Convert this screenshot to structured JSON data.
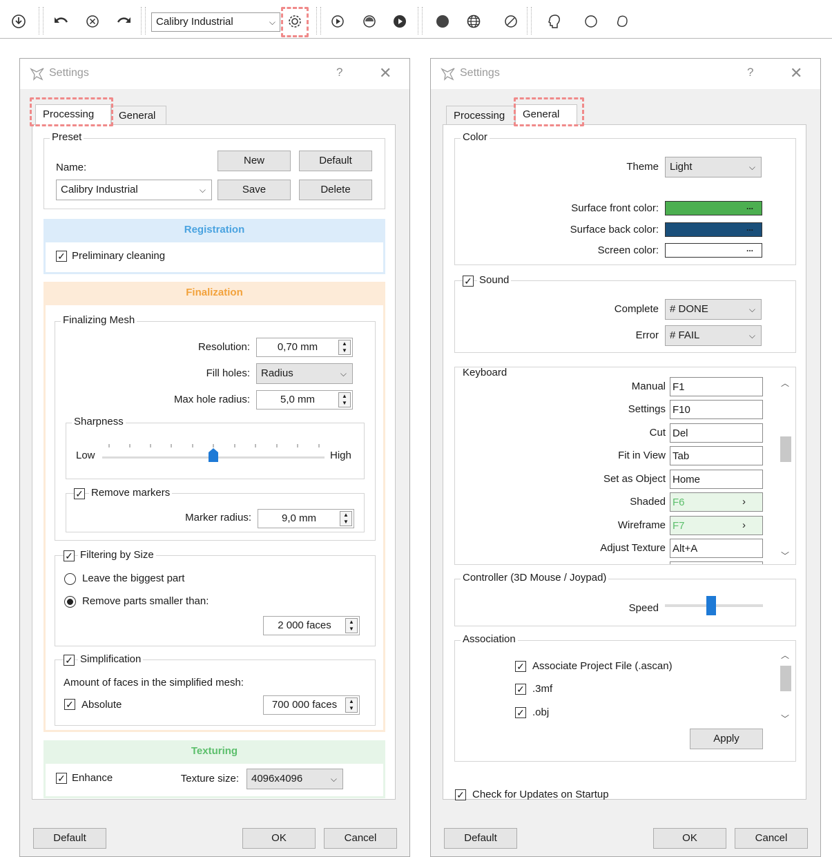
{
  "toolbar": {
    "preset_value": "Calibry Industrial",
    "icons": [
      "download-icon",
      "undo-icon",
      "cancel-icon",
      "redo-icon",
      "settings-gear-icon",
      "play-icon",
      "texture-icon",
      "play-filled-icon",
      "sphere-icon",
      "globe-icon",
      "block-icon",
      "head-icon",
      "circle-icon",
      "shape-icon"
    ]
  },
  "left": {
    "title": "Settings",
    "help": "?",
    "close": "✕",
    "tabs": {
      "processing": "Processing",
      "general": "General"
    },
    "preset": {
      "group": "Preset",
      "name_label": "Name:",
      "name_value": "Calibry Industrial",
      "new": "New",
      "default": "Default",
      "save": "Save",
      "delete": "Delete"
    },
    "registration": {
      "head": "Registration",
      "preliminary": "Preliminary cleaning"
    },
    "finalization": {
      "head": "Finalization",
      "mesh_group": "Finalizing Mesh",
      "resolution_label": "Resolution:",
      "resolution_value": "0,70 mm",
      "fill_label": "Fill holes:",
      "fill_value": "Radius",
      "maxhole_label": "Max hole radius:",
      "maxhole_value": "5,0 mm",
      "sharpness_group": "Sharpness",
      "low": "Low",
      "high": "High",
      "markers_group": "Remove markers",
      "marker_label": "Marker radius:",
      "marker_value": "9,0 mm",
      "filtering_group": "Filtering by Size",
      "biggest": "Leave the biggest part",
      "smaller": "Remove parts smaller than:",
      "faces_value": "2 000 faces",
      "simplification_group": "Simplification",
      "amount_label": "Amount of faces in the simplified mesh:",
      "absolute": "Absolute",
      "simp_value": "700 000 faces"
    },
    "texturing": {
      "head": "Texturing",
      "enhance": "Enhance",
      "size_label": "Texture size:",
      "size_value": "4096x4096"
    },
    "footer": {
      "default": "Default",
      "ok": "OK",
      "cancel": "Cancel"
    }
  },
  "right": {
    "title": "Settings",
    "help": "?",
    "close": "✕",
    "tabs": {
      "processing": "Processing",
      "general": "General"
    },
    "color": {
      "group": "Color",
      "theme_label": "Theme",
      "theme_value": "Light",
      "front_label": "Surface front color:",
      "front_color": "#4caf50",
      "back_label": "Surface back color:",
      "back_color": "#1a4f7a",
      "screen_label": "Screen color:",
      "screen_color": "#ffffff",
      "dots": "..."
    },
    "sound": {
      "group": "Sound",
      "complete_label": "Complete",
      "complete_value": "# DONE",
      "error_label": "Error",
      "error_value": "# FAIL"
    },
    "keyboard": {
      "group": "Keyboard",
      "rows": [
        {
          "label": "Manual",
          "value": "F1"
        },
        {
          "label": "Settings",
          "value": "F10"
        },
        {
          "label": "Cut",
          "value": "Del"
        },
        {
          "label": "Fit in View",
          "value": "Tab"
        },
        {
          "label": "Set as Object",
          "value": "Home"
        },
        {
          "label": "Shaded",
          "value": "F6"
        },
        {
          "label": "Wireframe",
          "value": "F7"
        },
        {
          "label": "Adjust Texture",
          "value": "Alt+A"
        }
      ]
    },
    "controller": {
      "group": "Controller (3D Mouse / Joypad)",
      "speed_label": "Speed"
    },
    "association": {
      "group": "Association",
      "items": [
        "Associate Project File (.ascan)",
        ".3mf",
        ".obj"
      ],
      "apply": "Apply"
    },
    "updates": "Check for Updates on Startup",
    "footer": {
      "default": "Default",
      "ok": "OK",
      "cancel": "Cancel"
    }
  }
}
